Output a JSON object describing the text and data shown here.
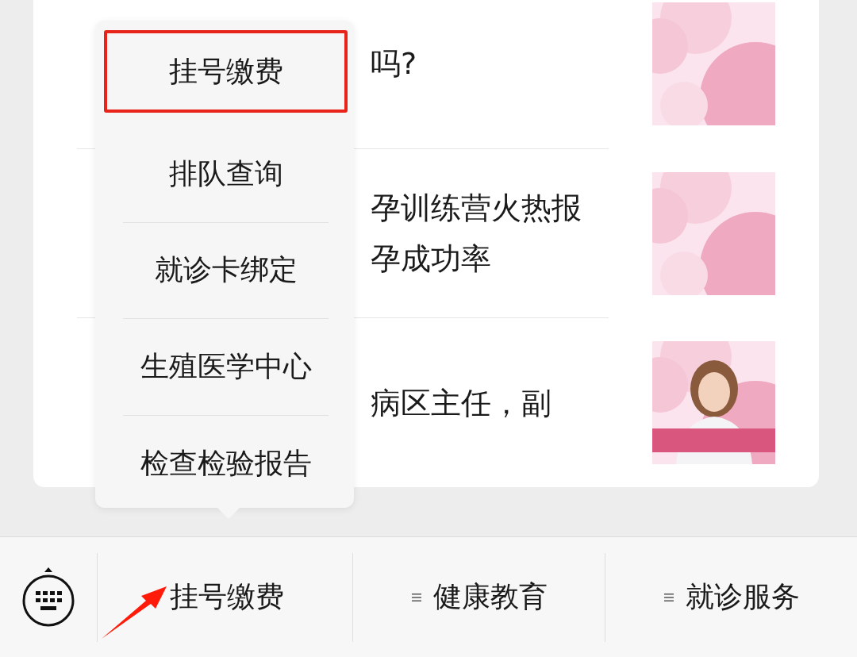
{
  "articles": [
    {
      "lines": [
        "吗?"
      ],
      "thumbnail": {
        "kind": "picture"
      }
    },
    {
      "lines": [
        "孕训练营火热报",
        "孕成功率"
      ],
      "thumbnail": {
        "kind": "picture"
      }
    },
    {
      "lines": [
        "病区主任，副"
      ],
      "thumbnail": {
        "kind": "picture"
      }
    }
  ],
  "popup_menu": {
    "items": [
      {
        "label": "挂号缴费",
        "selected": true
      },
      {
        "label": "排队查询",
        "selected": false
      },
      {
        "label": "就诊卡绑定",
        "selected": false
      },
      {
        "label": "生殖医学中心",
        "selected": false
      },
      {
        "label": "检查检验报告",
        "selected": false
      }
    ]
  },
  "bottom_menu": {
    "tabs": [
      {
        "label": "挂号缴费",
        "menu_icon": false,
        "expanded": true
      },
      {
        "label": "健康教育",
        "menu_icon": true,
        "expanded": false
      },
      {
        "label": "就诊服务",
        "menu_icon": true,
        "expanded": false
      }
    ]
  }
}
